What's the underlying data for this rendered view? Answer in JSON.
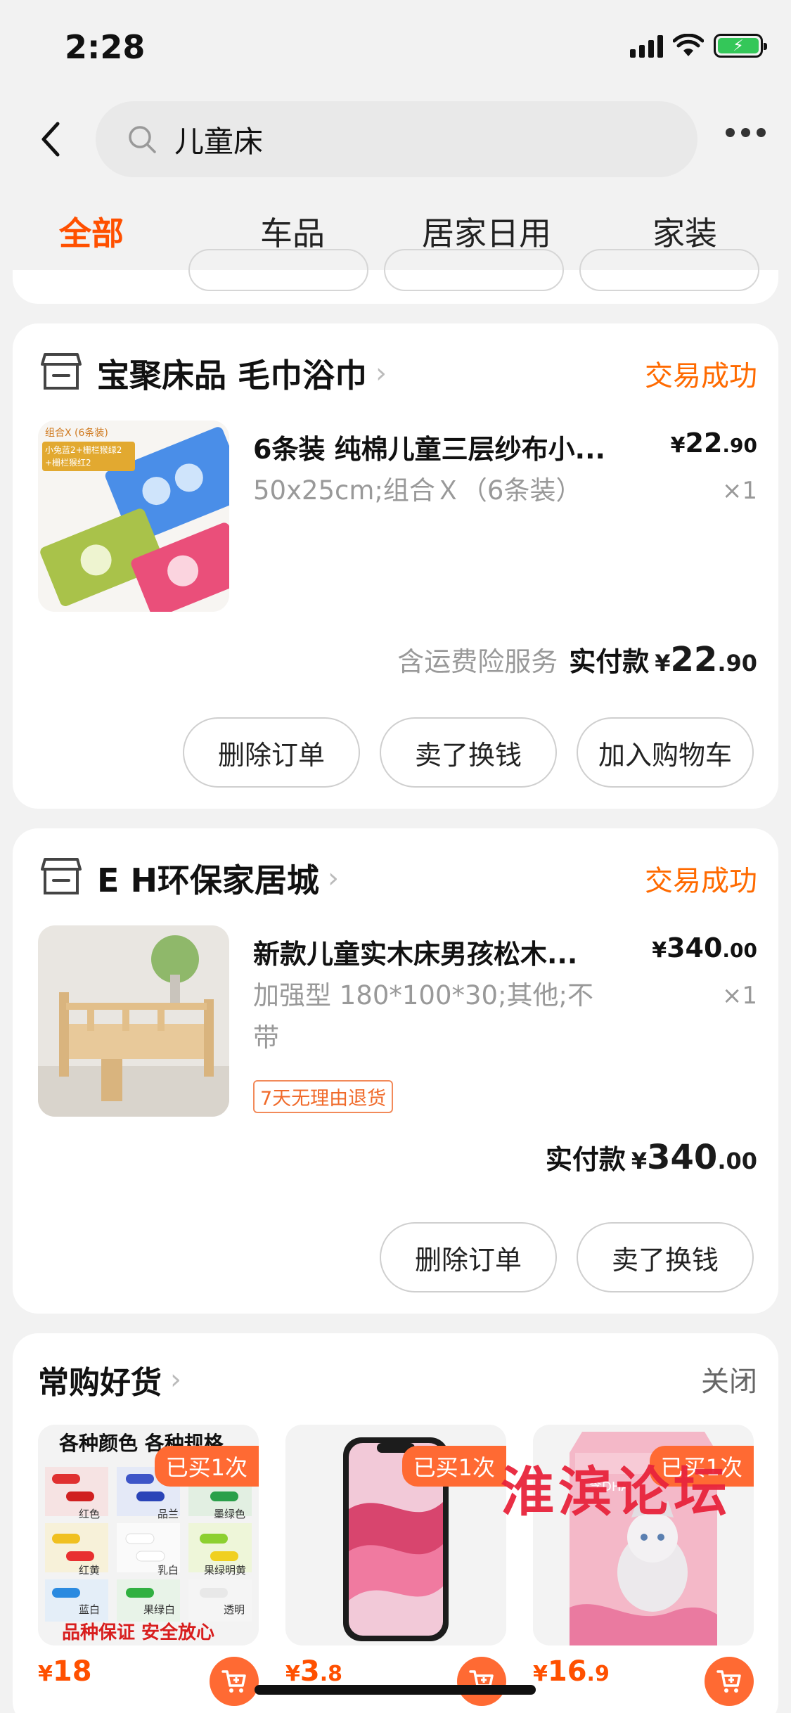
{
  "status_bar": {
    "time": "2:28"
  },
  "header": {
    "search_text": "儿童床"
  },
  "tabs": [
    {
      "label": "全部",
      "active": true
    },
    {
      "label": "车品",
      "active": false
    },
    {
      "label": "居家日用",
      "active": false
    },
    {
      "label": "家装",
      "active": false
    }
  ],
  "orders": [
    {
      "shop_name": "宝聚床品 毛巾浴巾",
      "status": "交易成功",
      "product_title": "6条装 纯棉儿童三层纱布小...",
      "spec": "50x25cm;组合Ｘ（6条装）",
      "price_int": "22",
      "price_dec": ".90",
      "qty": "×1",
      "service": "含运费险服务",
      "paid_label": "实付款",
      "paid_int": "22",
      "paid_dec": ".90",
      "thumb_label": "组合X (6条装)",
      "thumb_lines": [
        "小兔蓝2+栅栏猴绿2",
        "+栅栏猴红2"
      ],
      "buttons": [
        "删除订单",
        "卖了换钱",
        "加入购物车"
      ]
    },
    {
      "shop_name": "E H环保家居城",
      "status": "交易成功",
      "product_title": "新款儿童实木床男孩松木...",
      "spec_line1": "加强型 180*100*30;其他;不",
      "spec_line2": "带",
      "price_int": "340",
      "price_dec": ".00",
      "qty": "×1",
      "tag": "7天无理由退货",
      "paid_label": "实付款",
      "paid_int": "340",
      "paid_dec": ".00",
      "buttons": [
        "删除订单",
        "卖了换钱"
      ]
    }
  ],
  "recommend": {
    "title": "常购好货",
    "close": "关闭",
    "items": [
      {
        "badge": "已买1次",
        "price_int": "18",
        "price_dec": "",
        "overlay_top": "各种颜色 各种规格",
        "overlay_bottom": "品种保证 安全放心",
        "colors": [
          "红色",
          "品兰",
          "墨绿色",
          "红黄",
          "乳白",
          "果绿明黄",
          "蓝白",
          "果绿白",
          "透明"
        ]
      },
      {
        "badge": "已买1次",
        "price_int": "3",
        "price_dec": ".8"
      },
      {
        "badge": "已买1次",
        "price_int": "16",
        "price_dec": ".9",
        "pack_text": "含DHA"
      }
    ]
  },
  "watermark": "淮滨论坛",
  "currency": "¥",
  "colors": {
    "accent": "#ff5000",
    "status": "#ff6a00"
  }
}
